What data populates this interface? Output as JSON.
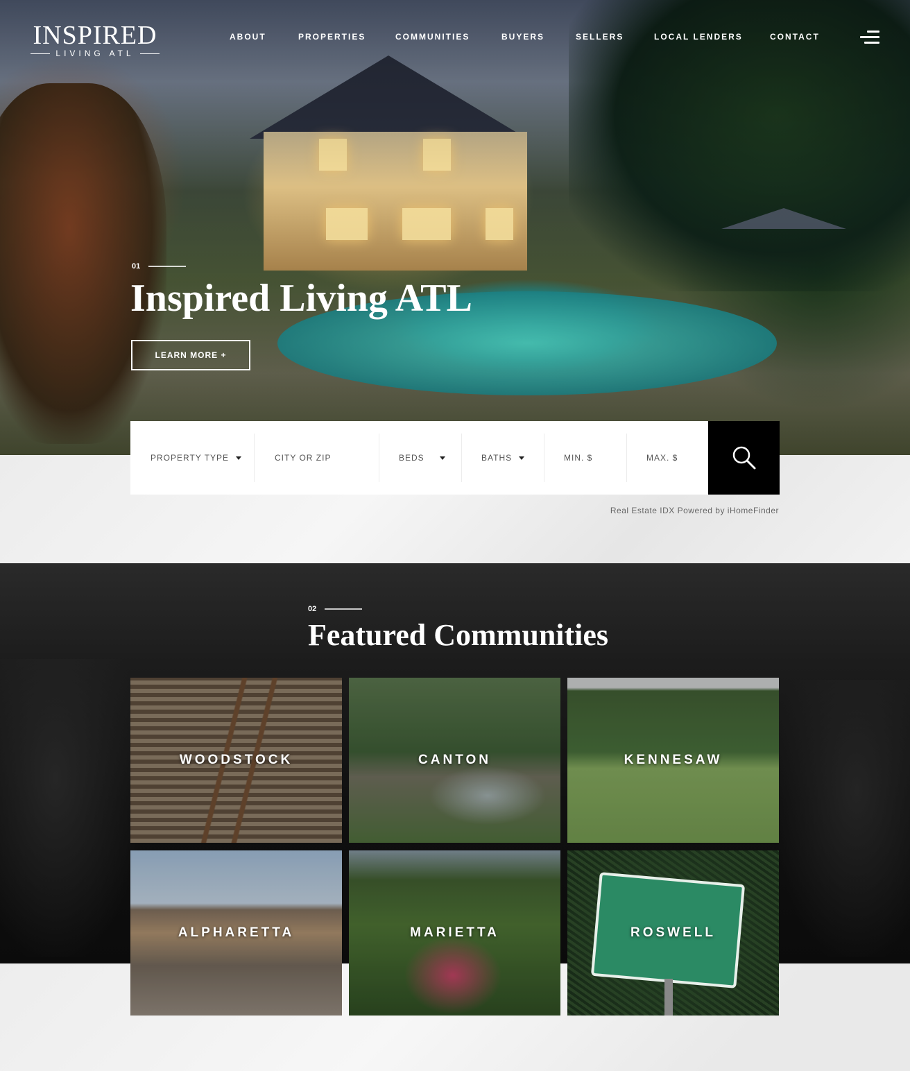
{
  "logo": {
    "main": "INSPIRED",
    "sub": "LIVING ATL"
  },
  "nav": [
    {
      "label": "ABOUT"
    },
    {
      "label": "PROPERTIES"
    },
    {
      "label": "COMMUNITIES"
    },
    {
      "label": "BUYERS"
    },
    {
      "label": "SELLERS"
    },
    {
      "label": "LOCAL LENDERS"
    },
    {
      "label": "CONTACT"
    }
  ],
  "hero": {
    "number": "01",
    "title": "Inspired Living ATL",
    "button": "LEARN MORE +"
  },
  "search": {
    "property_type": "PROPERTY TYPE",
    "city_placeholder": "CITY OR ZIP",
    "beds": "BEDS",
    "baths": "BATHS",
    "min_placeholder": "MIN. $",
    "max_placeholder": "MAX. $",
    "button_icon": "search-icon",
    "powered_by": "Real Estate IDX Powered by iHomeFinder"
  },
  "communities": {
    "number": "02",
    "title": "Featured Communities",
    "items": [
      {
        "label": "WOODSTOCK"
      },
      {
        "label": "CANTON"
      },
      {
        "label": "KENNESAW"
      },
      {
        "label": "ALPHARETTA"
      },
      {
        "label": "MARIETTA"
      },
      {
        "label": "ROSWELL"
      }
    ]
  },
  "colors": {
    "search_button": "#000000",
    "dark_section": "#141414",
    "text_light": "#ffffff"
  }
}
